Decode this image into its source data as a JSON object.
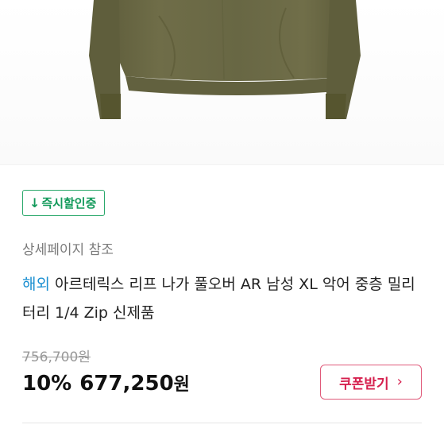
{
  "badge": {
    "icon": "down-arrow-icon",
    "arrow": "↓",
    "label": "즉시할인중",
    "color": "#139a5b"
  },
  "detail_reference": "상세페이지 참조",
  "product": {
    "tag": "해외",
    "title": "아르테릭스 리프 나가 풀오버 AR 남성 XL 악어 중층 밀리터리 1/4 Zip 신제품"
  },
  "pricing": {
    "original_price": "756,700원",
    "discount": "10%",
    "sale_price": "677,250",
    "currency": "원"
  },
  "coupon": {
    "label": "쿠폰받기",
    "icon": "chevron-right-icon",
    "chevron": "›",
    "color": "#d6204e"
  },
  "colors": {
    "garment": "#6b6a45",
    "tag": "#1a8fd1"
  }
}
